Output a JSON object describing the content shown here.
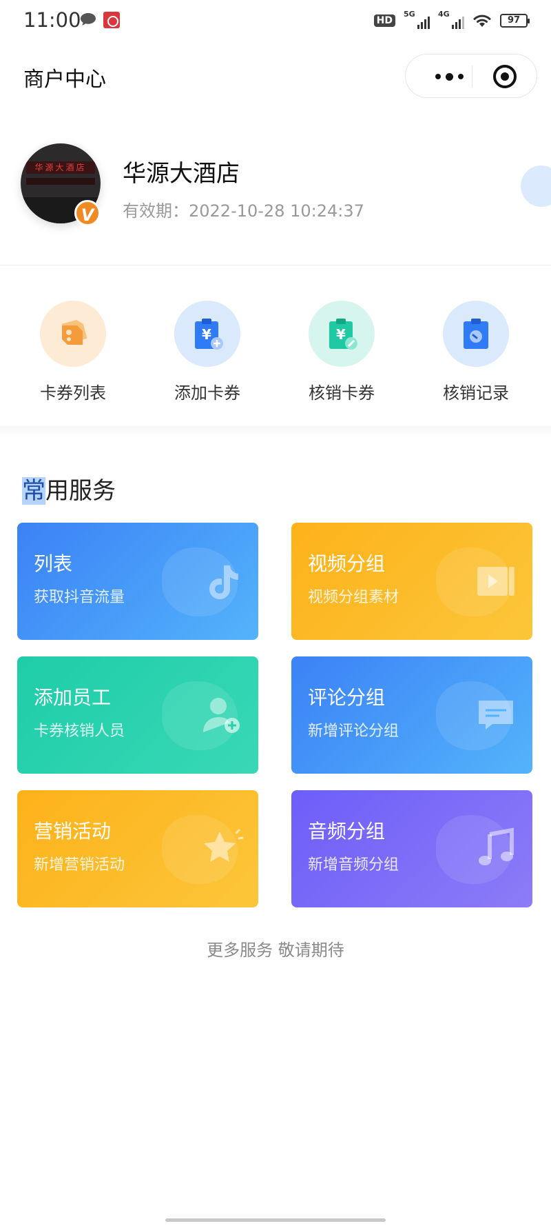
{
  "status_bar": {
    "time": "11:00",
    "icons": [
      "chat-bubble-icon",
      "app-notification-icon"
    ],
    "hd": "HD",
    "net1": "5G",
    "net2": "4G",
    "battery": "97"
  },
  "nav": {
    "title": "商户中心",
    "more_icon": "more-dots-icon",
    "close_icon": "target-close-icon"
  },
  "merchant": {
    "name": "华源大酒店",
    "validity": "有效期：2022-10-28 10:24:37",
    "avatar_sign": "华源大酒店",
    "verified_badge": "V"
  },
  "quick_actions": [
    {
      "label": "卡券列表",
      "icon": "coupon-tags-icon",
      "bg": "#fdebd6",
      "color": "#f49b3b"
    },
    {
      "label": "添加卡券",
      "icon": "add-coupon-icon",
      "bg": "#dbe9fd",
      "color": "#2f7cf6"
    },
    {
      "label": "核销卡券",
      "icon": "redeem-coupon-icon",
      "bg": "#d6f5ee",
      "color": "#1ec9a3"
    },
    {
      "label": "核销记录",
      "icon": "redeem-record-icon",
      "bg": "#dbe9fd",
      "color": "#2f7cf6"
    }
  ],
  "services": {
    "title_highlight": "常",
    "title_rest": "用服务",
    "cards": [
      {
        "title": "列表",
        "subtitle": "获取抖音流量",
        "icon": "tiktok-icon",
        "theme": "blue"
      },
      {
        "title": "视频分组",
        "subtitle": "视频分组素材",
        "icon": "video-icon",
        "theme": "yellow"
      },
      {
        "title": "添加员工",
        "subtitle": "卡券核销人员",
        "icon": "add-staff-icon",
        "theme": "teal"
      },
      {
        "title": "评论分组",
        "subtitle": "新增评论分组",
        "icon": "comment-icon",
        "theme": "blue"
      },
      {
        "title": "营销活动",
        "subtitle": "新增营销活动",
        "icon": "star-icon",
        "theme": "yellow"
      },
      {
        "title": "音频分组",
        "subtitle": "新增音频分组",
        "icon": "music-icon",
        "theme": "purple"
      }
    ],
    "footer": "更多服务 敬请期待"
  }
}
